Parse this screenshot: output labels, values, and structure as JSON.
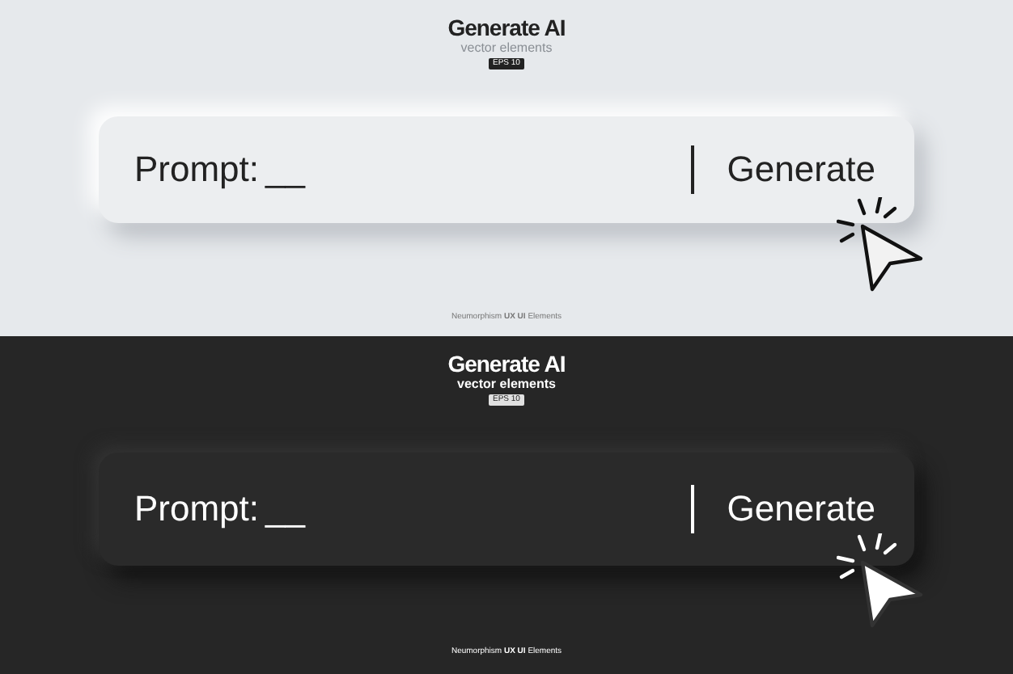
{
  "panels": [
    {
      "kind": "light",
      "title": "Generate AI",
      "subtitle": "vector elements",
      "badge": "EPS 10",
      "prompt_label": "Prompt:",
      "prompt_value": "__",
      "button": "Generate",
      "footer": "Neumorphism **UX UI** Elements"
    },
    {
      "kind": "dark",
      "title": "Generate AI",
      "subtitle": "vector elements",
      "badge": "EPS 10",
      "prompt_label": "Prompt:",
      "prompt_value": "__",
      "button": "Generate",
      "footer": "Neumorphism **UX UI** Elements"
    }
  ]
}
